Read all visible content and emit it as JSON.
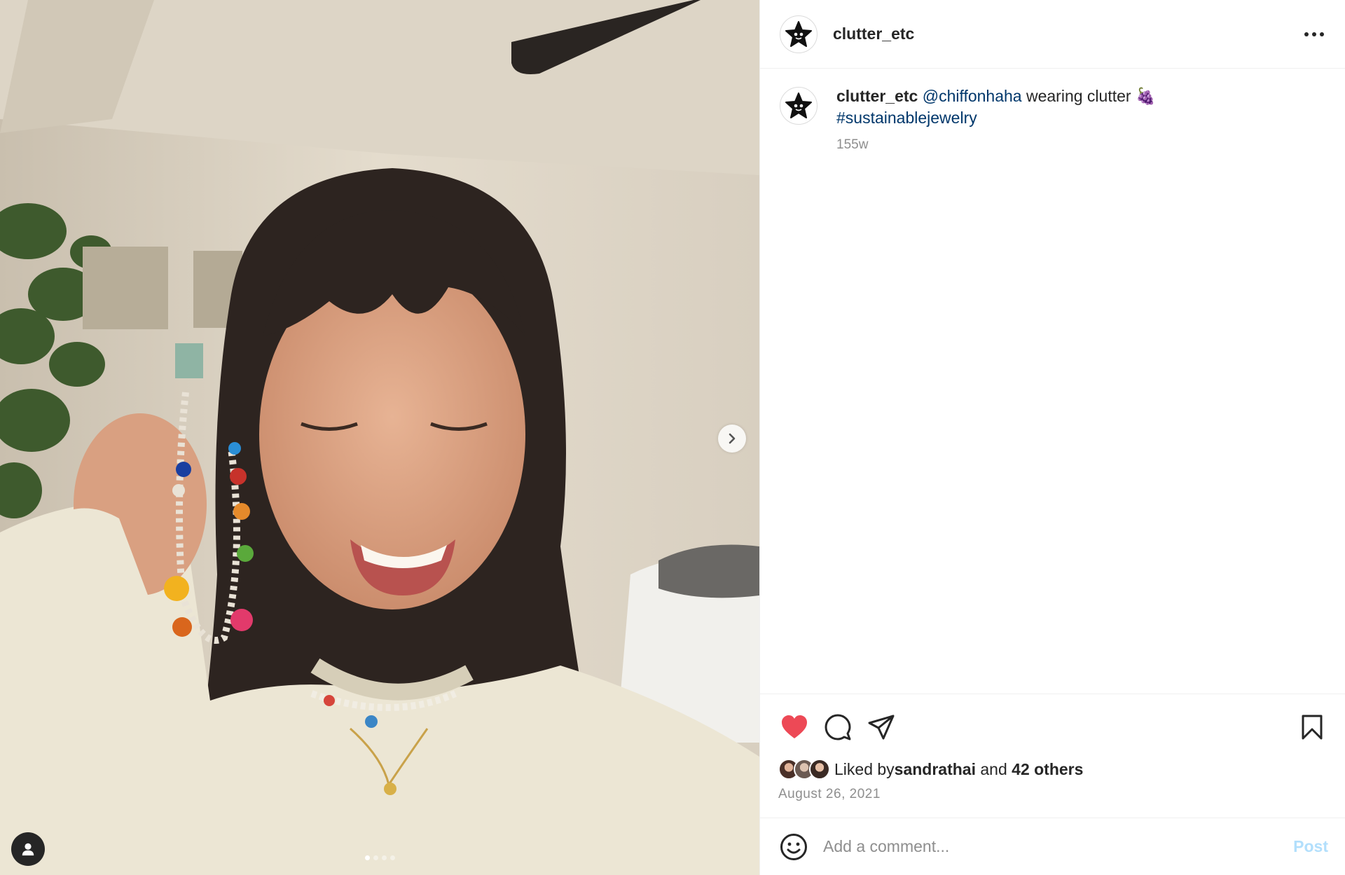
{
  "header": {
    "username": "clutter_etc"
  },
  "caption": {
    "username": "clutter_etc",
    "mention": "@chiffonhaha",
    "text": " wearing clutter ",
    "emoji": "🍇",
    "hashtag": "#sustainablejewelry",
    "timestamp": "155w"
  },
  "likes": {
    "prefix": "Liked by ",
    "user": "sandrathai",
    "middle": " and ",
    "others": "42 others",
    "liked": true
  },
  "date": "August 26, 2021",
  "comment": {
    "placeholder": "Add a comment...",
    "post_label": "Post"
  },
  "carousel": {
    "count": 4,
    "active_index": 0
  },
  "colors": {
    "heart": "#ed4956",
    "link": "#00376b",
    "post_disabled": "#b2dffc"
  },
  "icons": [
    "more-icon",
    "heart-icon",
    "comment-icon",
    "share-icon",
    "bookmark-icon",
    "emoji-icon",
    "chevron-right-icon",
    "user-tag-icon"
  ]
}
